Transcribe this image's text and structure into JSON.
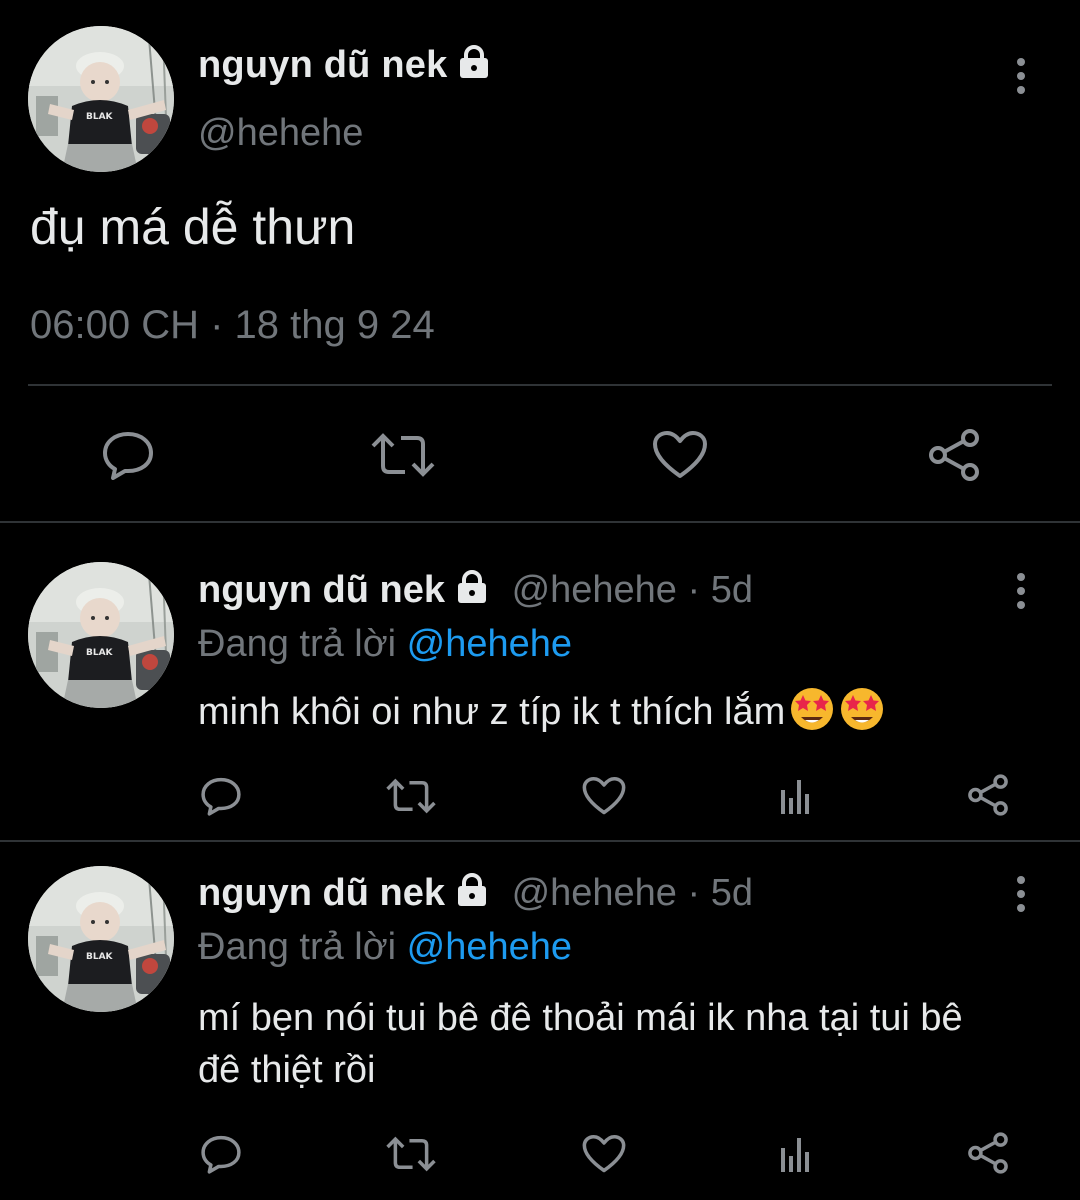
{
  "tweet": {
    "display_name": "nguyn dũ nek",
    "handle": "@hehehe",
    "text": "đụ má dễ thưn",
    "timestamp": "06:00 CH · 18 thg 9 24"
  },
  "replies": [
    {
      "display_name": "nguyn dũ nek",
      "handle": "@hehehe",
      "age": "· 5d",
      "replying_prefix": "Đang trả lời",
      "replying_to": "@hehehe",
      "text": "minh khôi oi như z típ ik t thích lắm",
      "emojis": [
        "star-struck-emoji",
        "star-struck-emoji"
      ]
    },
    {
      "display_name": "nguyn dũ nek",
      "handle": "@hehehe",
      "age": "· 5d",
      "replying_prefix": "Đang trả lời",
      "replying_to": "@hehehe",
      "text": "mí bẹn nói tui bê đê thoải mái ik nha tại tui bê đê thiệt rồi"
    }
  ],
  "avatar_text": "BLAK",
  "icons": [
    "lock-icon",
    "more-icon",
    "reply-icon",
    "retweet-icon",
    "like-icon",
    "views-icon",
    "share-icon"
  ],
  "colors": {
    "background": "#000000",
    "text": "#e7e9ea",
    "secondary": "#71767b",
    "link": "#1d9bf0",
    "divider": "#2f3336"
  }
}
